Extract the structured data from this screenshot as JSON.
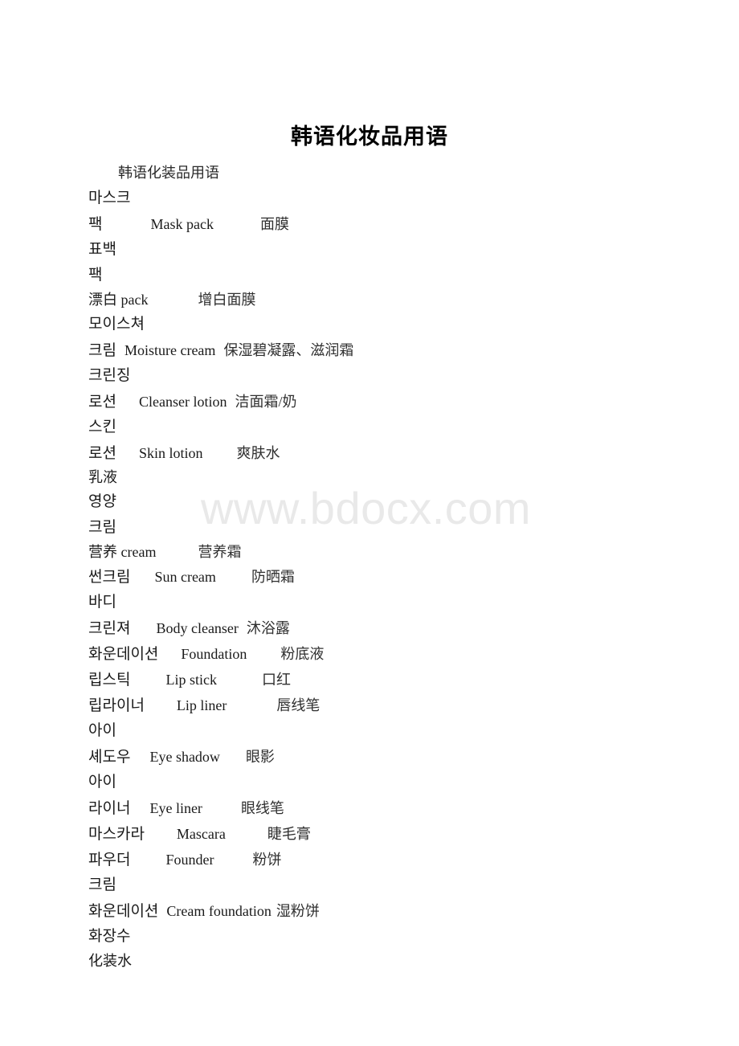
{
  "document": {
    "title": "韩语化妆品用语",
    "subtitle": "韩语化装品用语",
    "watermark": "www.bdocx.com",
    "watermark_color": "#e9e9e9"
  },
  "lines": [
    {
      "id": "l01",
      "type": "kr",
      "kr": "마스크",
      "en": "",
      "cn": "",
      "en_indent": 0,
      "cn_indent": 0
    },
    {
      "id": "l02",
      "type": "kr",
      "kr": "팩",
      "en": "Mask pack",
      "cn": "面膜",
      "en_indent": 60,
      "cn_indent": 58
    },
    {
      "id": "l03",
      "type": "kr",
      "kr": "표백",
      "en": "",
      "cn": "",
      "en_indent": 0,
      "cn_indent": 0
    },
    {
      "id": "l04",
      "type": "kr",
      "kr": "팩",
      "en": "",
      "cn": "",
      "en_indent": 0,
      "cn_indent": 0
    },
    {
      "id": "l05",
      "type": "cn",
      "kr": "",
      "en": "漂白 pack",
      "cn": "增白面膜",
      "en_indent": 0,
      "cn_indent": 62
    },
    {
      "id": "l06",
      "type": "kr",
      "kr": "모이스쳐",
      "en": "",
      "cn": "",
      "en_indent": 0,
      "cn_indent": 0
    },
    {
      "id": "l07",
      "type": "kr",
      "kr": "크림",
      "en": "Moisture cream",
      "cn": "保湿碧凝露、滋润霜",
      "en_indent": 10,
      "cn_indent": 10
    },
    {
      "id": "l08",
      "type": "kr",
      "kr": "크린징",
      "en": "",
      "cn": "",
      "en_indent": 0,
      "cn_indent": 0
    },
    {
      "id": "l09",
      "type": "kr",
      "kr": "로션",
      "en": "Cleanser lotion",
      "cn": "洁面霜/奶",
      "en_indent": 28,
      "cn_indent": 10
    },
    {
      "id": "l10",
      "type": "kr",
      "kr": "스킨",
      "en": "",
      "cn": "",
      "en_indent": 0,
      "cn_indent": 0
    },
    {
      "id": "l11",
      "type": "kr",
      "kr": "로션",
      "en": "Skin lotion",
      "cn": "爽肤水",
      "en_indent": 28,
      "cn_indent": 42
    },
    {
      "id": "l12",
      "type": "cn",
      "kr": "",
      "en": "乳液",
      "cn": "",
      "en_indent": 0,
      "cn_indent": 0
    },
    {
      "id": "l13",
      "type": "kr",
      "kr": "영양",
      "en": "",
      "cn": "",
      "en_indent": 0,
      "cn_indent": 0
    },
    {
      "id": "l14",
      "type": "kr",
      "kr": "크림",
      "en": "",
      "cn": "",
      "en_indent": 0,
      "cn_indent": 0
    },
    {
      "id": "l15",
      "type": "cn",
      "kr": "",
      "en": "营养 cream",
      "cn": "营养霜",
      "en_indent": 0,
      "cn_indent": 52
    },
    {
      "id": "l16",
      "type": "kr",
      "kr": "썬크림",
      "en": "Sun cream",
      "cn": "防晒霜",
      "en_indent": 30,
      "cn_indent": 44
    },
    {
      "id": "l17",
      "type": "kr",
      "kr": "바디",
      "en": "",
      "cn": "",
      "en_indent": 0,
      "cn_indent": 0
    },
    {
      "id": "l18",
      "type": "kr",
      "kr": "크린져",
      "en": "Body cleanser",
      "cn": "沐浴露",
      "en_indent": 32,
      "cn_indent": 10
    },
    {
      "id": "l19",
      "type": "kr",
      "kr": "화운데이션",
      "en": "Foundation",
      "cn": "粉底液",
      "en_indent": 28,
      "cn_indent": 42
    },
    {
      "id": "l20",
      "type": "kr",
      "kr": "립스틱",
      "en": "Lip stick",
      "cn": "口红",
      "en_indent": 44,
      "cn_indent": 56
    },
    {
      "id": "l21",
      "type": "kr",
      "kr": "립라이너",
      "en": "Lip liner",
      "cn": "唇线笔",
      "en_indent": 40,
      "cn_indent": 62
    },
    {
      "id": "l22",
      "type": "kr",
      "kr": "아이",
      "en": "",
      "cn": "",
      "en_indent": 0,
      "cn_indent": 0
    },
    {
      "id": "l23",
      "type": "kr",
      "kr": "셰도우",
      "en": "Eye shadow",
      "cn": "眼影",
      "en_indent": 24,
      "cn_indent": 32
    },
    {
      "id": "l24",
      "type": "kr",
      "kr": "아이",
      "en": "",
      "cn": "",
      "en_indent": 0,
      "cn_indent": 0
    },
    {
      "id": "l25",
      "type": "kr",
      "kr": "라이너",
      "en": "Eye liner",
      "cn": "眼线笔",
      "en_indent": 24,
      "cn_indent": 48
    },
    {
      "id": "l26",
      "type": "kr",
      "kr": "마스카라",
      "en": "Mascara",
      "cn": "睫毛膏",
      "en_indent": 40,
      "cn_indent": 52
    },
    {
      "id": "l27",
      "type": "kr",
      "kr": "파우더",
      "en": "Founder",
      "cn": "粉饼",
      "en_indent": 44,
      "cn_indent": 48
    },
    {
      "id": "l28",
      "type": "kr",
      "kr": "크림",
      "en": "",
      "cn": "",
      "en_indent": 0,
      "cn_indent": 0
    },
    {
      "id": "l29",
      "type": "kr",
      "kr": "화운데이션",
      "en": "Cream foundation",
      "cn": "湿粉饼",
      "en_indent": 10,
      "cn_indent": 6
    },
    {
      "id": "l30",
      "type": "kr",
      "kr": "화장수",
      "en": "",
      "cn": "",
      "en_indent": 0,
      "cn_indent": 0
    },
    {
      "id": "l31",
      "type": "cn",
      "kr": "",
      "en": "化装水",
      "cn": "",
      "en_indent": 0,
      "cn_indent": 0
    }
  ]
}
